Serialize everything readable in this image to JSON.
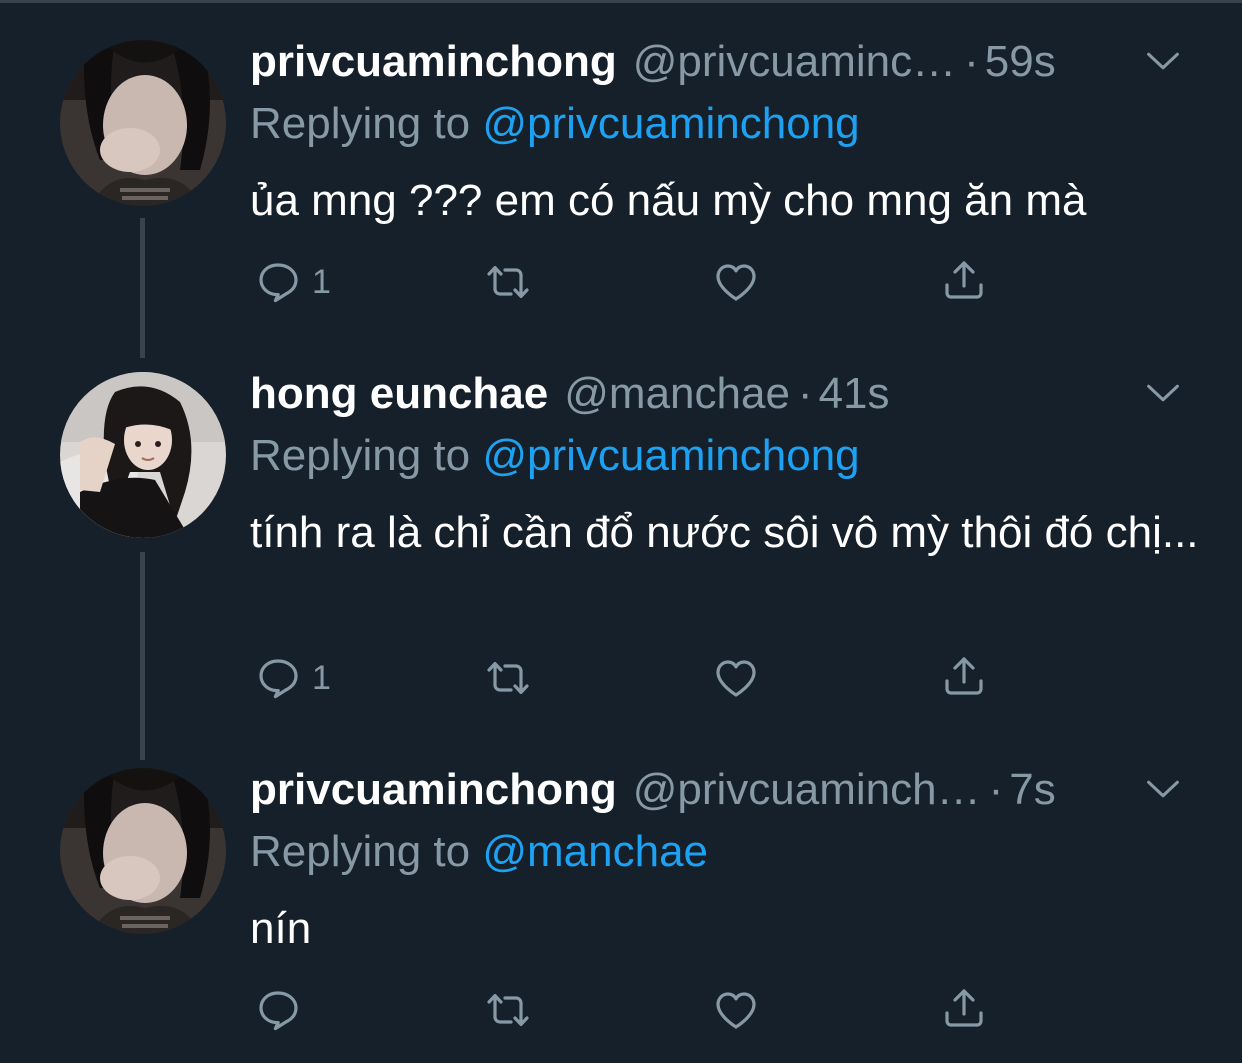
{
  "colors": {
    "background": "#15202b",
    "divider": "#38444d",
    "secondary_text": "#8899a6",
    "accent": "#1da1f2",
    "primary_text": "#ffffff"
  },
  "tweets": [
    {
      "display_name": "privcuaminchong",
      "handle": "@privcuaminc…",
      "time": "59s",
      "replying_prefix": "Replying to ",
      "replying_to": "@privcuaminchong",
      "text": "ủa mng ??? em có nấu mỳ cho mng ăn mà",
      "reply_count": "1",
      "icons": [
        "reply-icon",
        "retweet-icon",
        "like-icon",
        "share-icon",
        "chevron-down-icon"
      ]
    },
    {
      "display_name": "hong eunchae",
      "handle": "@manchae",
      "time": "41s",
      "replying_prefix": "Replying to ",
      "replying_to": "@privcuaminchong",
      "text": "tính ra là chỉ cần đổ nước sôi vô mỳ thôi đó chị...",
      "reply_count": "1",
      "icons": [
        "reply-icon",
        "retweet-icon",
        "like-icon",
        "share-icon",
        "chevron-down-icon"
      ]
    },
    {
      "display_name": "privcuaminchong",
      "handle": "@privcuaminch…",
      "time": "7s",
      "replying_prefix": "Replying to ",
      "replying_to": "@manchae",
      "text": "nín",
      "reply_count": "",
      "icons": [
        "reply-icon",
        "retweet-icon",
        "like-icon",
        "share-icon",
        "chevron-down-icon"
      ]
    }
  ]
}
